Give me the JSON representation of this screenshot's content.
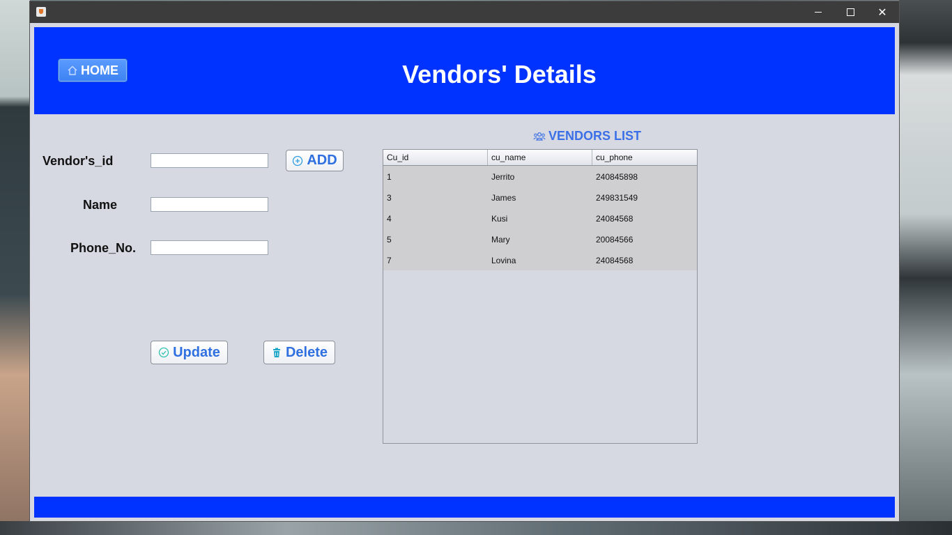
{
  "window": {
    "title": "",
    "accent_color": "#0033ff",
    "background_color": "#d6d9e1"
  },
  "header": {
    "home_label": "HOME",
    "home_icon": "home-icon",
    "title": "Vendors' Details"
  },
  "form": {
    "vendor_id_label": "Vendor's_id",
    "vendor_id_value": "",
    "name_label": "Name",
    "name_value": "",
    "phone_label": "Phone_No.",
    "phone_value": "",
    "add_label": "ADD",
    "add_icon": "plus-circle-icon",
    "update_label": "Update",
    "update_icon": "check-circle-icon",
    "delete_label": "Delete",
    "delete_icon": "trash-icon"
  },
  "vendors_list": {
    "title": "VENDORS LIST",
    "title_icon": "users-icon",
    "columns": [
      "Cu_id",
      "cu_name",
      "cu_phone"
    ],
    "rows": [
      [
        "1",
        "Jerrito",
        "240845898"
      ],
      [
        "3",
        "James",
        "249831549"
      ],
      [
        "4",
        "Kusi",
        "24084568"
      ],
      [
        "5",
        "Mary",
        "20084566"
      ],
      [
        "7",
        "Lovina",
        "24084568"
      ]
    ]
  }
}
